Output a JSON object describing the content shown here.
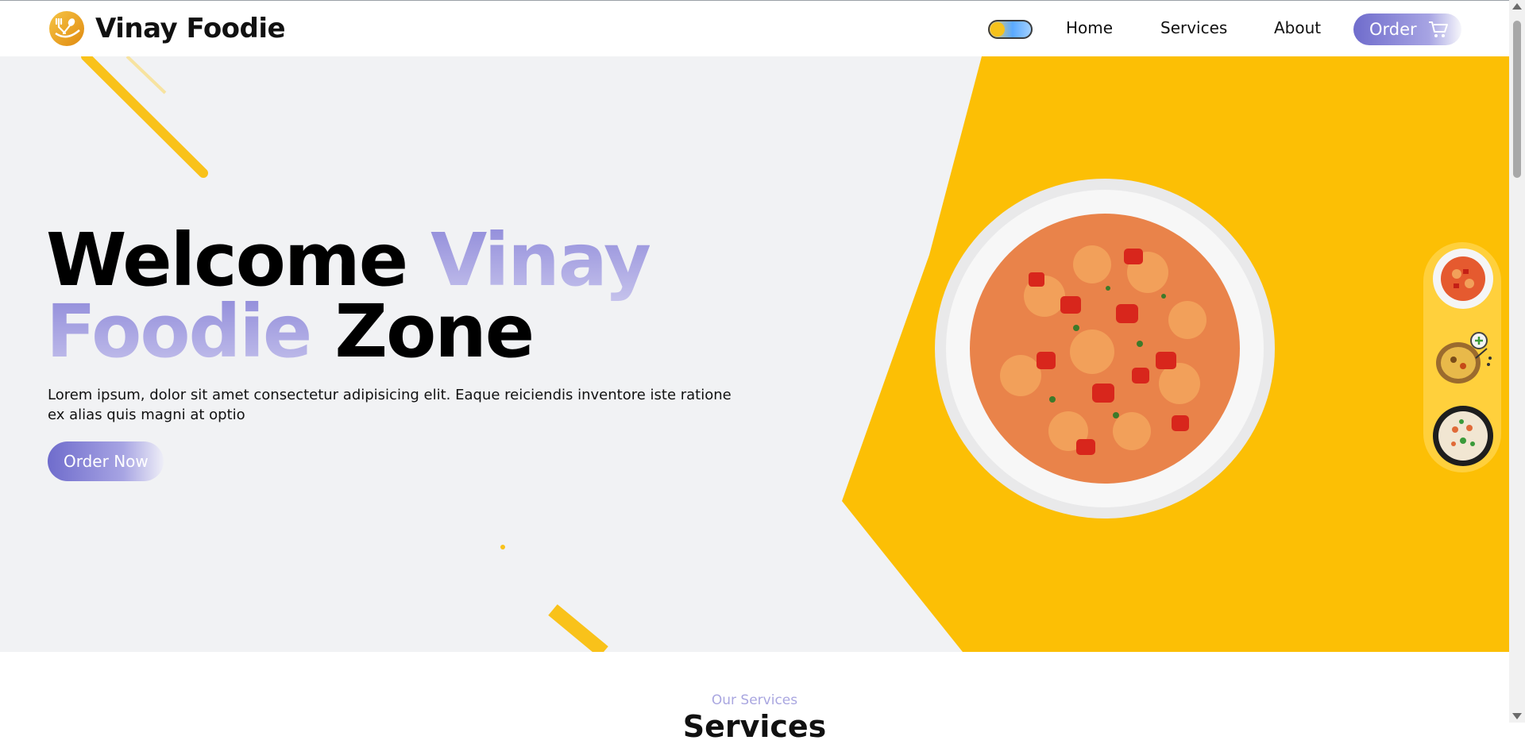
{
  "brand": {
    "name": "Vinay Foodie",
    "logo_icon": "fork-spoon-logo-icon",
    "logo_color": "#f0a21a"
  },
  "theme_toggle": {
    "icon": "sun-cloud-toggle-icon"
  },
  "nav": {
    "links": [
      "Home",
      "Services",
      "About"
    ],
    "order_label": "Order",
    "order_icon": "cart-icon"
  },
  "hero": {
    "title_word1": "Welcome",
    "title_word2": "Vinay",
    "title_word3": "Foodie",
    "title_word4": "Zone",
    "description": "Lorem ipsum, dolor sit amet consectetur adipisicing elit. Eaque reiciendis inventore iste ratione ex alias quis magni at optio",
    "cta_label": "Order Now",
    "accent_color": "#fbbf08",
    "gradient_color": "#8d88d9"
  },
  "menu_thumbs": [
    "pasta-plate-icon",
    "biryani-plate-icon",
    "fried-rice-plate-icon"
  ],
  "services": {
    "subtitle": "Our Services",
    "title": "Services"
  }
}
